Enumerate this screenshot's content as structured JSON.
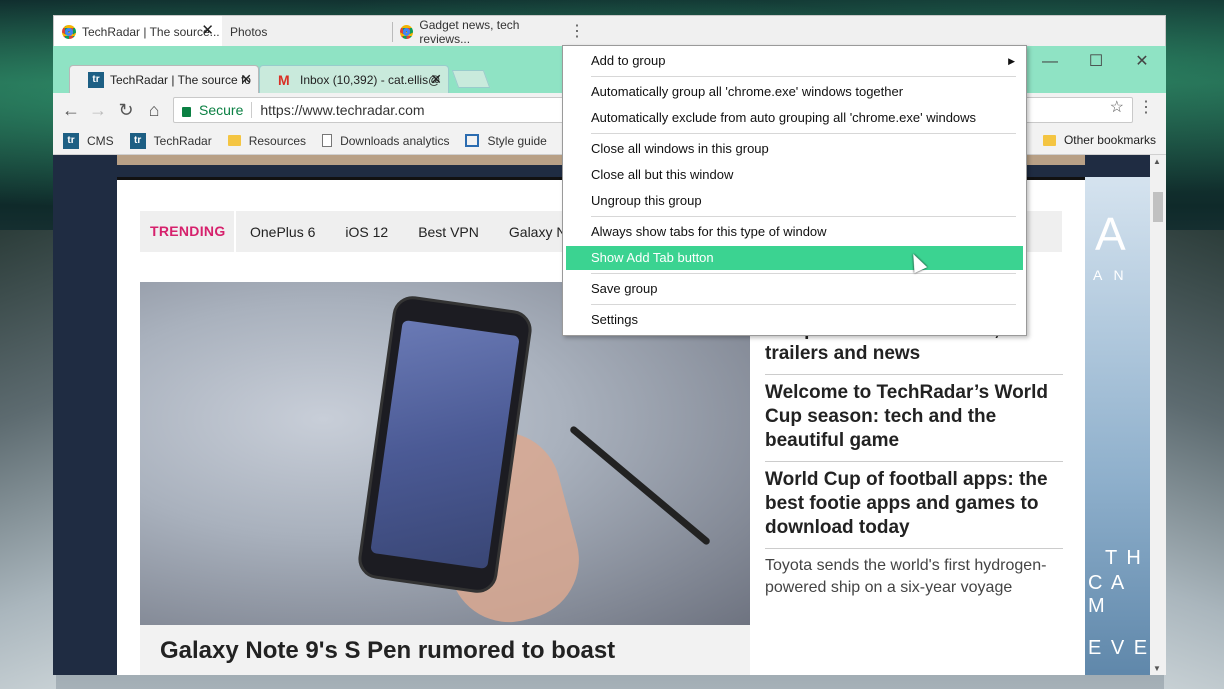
{
  "group_tabs": [
    {
      "title": "TechRadar | The source...",
      "active": true
    },
    {
      "title": "Photos",
      "active": false
    },
    {
      "title": "Gadget news, tech reviews...",
      "active": false
    }
  ],
  "browser": {
    "tabs": [
      {
        "title": "TechRadar | The source fo",
        "favicon": "tr"
      },
      {
        "title": "Inbox (10,392) - cat.ellis@",
        "favicon": "M"
      }
    ],
    "window_controls": {
      "minimize": "—",
      "maximize": "☐",
      "close": "✕"
    },
    "address": {
      "secure_label": "Secure",
      "url": "https://www.techradar.com"
    },
    "bookmarks": [
      {
        "label": "CMS",
        "icon": "tr"
      },
      {
        "label": "TechRadar",
        "icon": "tr"
      },
      {
        "label": "Resources",
        "icon": "folder-icon"
      },
      {
        "label": "Downloads analytics",
        "icon": "page-icon"
      },
      {
        "label": "Style guide",
        "icon": "trello-icon"
      }
    ],
    "other_bookmarks": "Other bookmarks"
  },
  "page": {
    "trending_label": "TRENDING",
    "trending": [
      "OnePlus 6",
      "iOS 12",
      "Best VPN",
      "Galaxy N"
    ],
    "hero_title": "Galaxy Note 9's S Pen rumored to boast",
    "side_stories": [
      {
        "title": "Jump Force: release date, trailers and news",
        "bold": true
      },
      {
        "title": "Welcome to TechRadar’s World Cup season: tech and the beautiful game",
        "bold": true
      },
      {
        "title": "World Cup of football apps: the best footie apps and games to download today",
        "bold": true
      },
      {
        "title": "Toyota sends the world's first hydrogen-powered ship on a six-year voyage",
        "bold": false
      }
    ],
    "ad": {
      "big": "A",
      "line1": "A N",
      "line2": "T H",
      "line3": "C A M",
      "line4": "E V E"
    }
  },
  "context_menu": {
    "items": [
      {
        "label": "Add to group",
        "submenu": true
      },
      {
        "label": "Automatically group all 'chrome.exe' windows together"
      },
      {
        "label": "Automatically exclude from auto grouping all 'chrome.exe' windows"
      },
      {
        "label": "Close all windows in this group"
      },
      {
        "label": "Close all but this window"
      },
      {
        "label": "Ungroup this group"
      },
      {
        "label": "Always show tabs for this type of window"
      },
      {
        "label": "Show Add Tab button",
        "highlighted": true
      },
      {
        "label": "Save group"
      },
      {
        "label": "Settings"
      }
    ]
  },
  "colors": {
    "titlebar": "#8fe3c4",
    "menu_highlight": "#3bd391",
    "trending_accent": "#d6216c",
    "secure_green": "#0b8043"
  }
}
